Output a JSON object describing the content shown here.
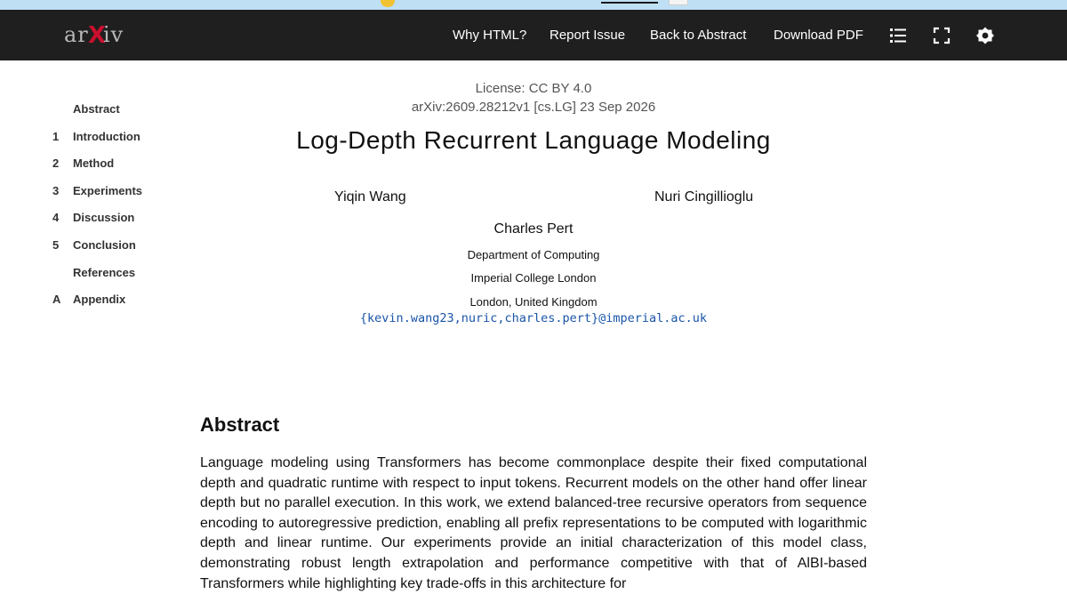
{
  "header": {
    "logo_text": "arXiv",
    "nav": {
      "why_html": "Why HTML?",
      "report_issue": "Report Issue",
      "back_to_abstract": "Back to Abstract",
      "download_pdf": "Download PDF"
    },
    "icons": [
      "list-icon",
      "fullscreen-icon",
      "settings-icon"
    ]
  },
  "toc": {
    "items": [
      {
        "num": "",
        "label": "Abstract"
      },
      {
        "num": "1",
        "label": "Introduction"
      },
      {
        "num": "2",
        "label": "Method"
      },
      {
        "num": "3",
        "label": "Experiments"
      },
      {
        "num": "4",
        "label": "Discussion"
      },
      {
        "num": "5",
        "label": "Conclusion"
      },
      {
        "num": "",
        "label": "References"
      },
      {
        "num": "A",
        "label": "Appendix"
      }
    ]
  },
  "paper": {
    "license": "License: CC BY 4.0",
    "arxiv_id": "arXiv:2609.28212v1 [cs.LG] 23 Sep 2026",
    "title": "Log-Depth Recurrent Language Modeling",
    "authors": [
      "Yiqin Wang",
      "Nuri Cingillioglu",
      "Charles Pert"
    ],
    "affiliation": {
      "department": "Department of Computing",
      "institution": "Imperial College London",
      "location": "London, United Kingdom"
    },
    "email": "{kevin.wang23,nuric,charles.pert}@imperial.ac.uk",
    "abstract_heading": "Abstract",
    "abstract_text": "Language modeling using Transformers has become commonplace despite their fixed computational depth and quadratic runtime with respect to input tokens. Recurrent models on the other hand offer linear depth but no parallel execution. In this work, we extend balanced-tree recursive operators from sequence encoding to autoregressive prediction, enabling all prefix representations to be computed with logarithmic depth and linear runtime. Our experiments provide an initial characterization of this model class, demonstrating robust length extrapolation and performance competitive with that of AlBI-based Transformers while highlighting key trade-offs in this architecture for"
  },
  "colors": {
    "header_bg": "#1f1f1f",
    "logo_accent": "#c8102e",
    "link": "#1a55a8"
  }
}
